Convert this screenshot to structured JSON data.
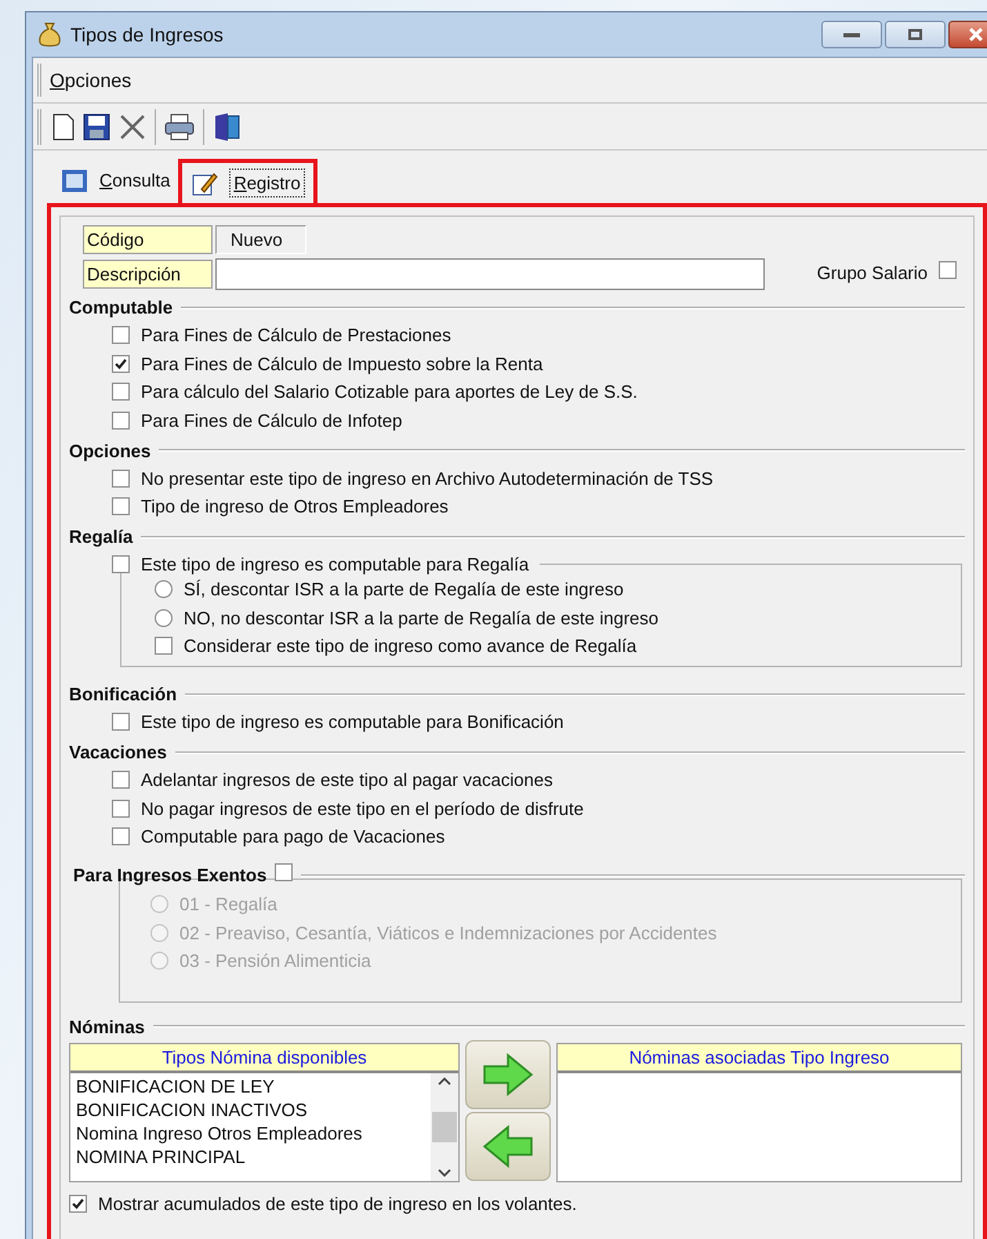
{
  "window": {
    "title": "Tipos de Ingresos"
  },
  "menu": [
    {
      "label": "Opciones"
    }
  ],
  "tabs": [
    {
      "label": "Consulta",
      "selected": false
    },
    {
      "label": "Registro",
      "selected": true
    }
  ],
  "form": {
    "code_label": "Código",
    "code_value": "Nuevo",
    "description_label": "Descripción",
    "group_label": "Grupo Salario",
    "group_checked": false
  },
  "sections": [
    {
      "title": "Computable",
      "kind": "list",
      "items": [
        {
          "kind": "checkbox",
          "label": "Para Fines de Cálculo de Prestaciones",
          "checked": false
        },
        {
          "kind": "checkbox",
          "label": "Para Fines de Cálculo de Impuesto sobre la Renta",
          "checked": true
        },
        {
          "kind": "checkbox",
          "label": "Para cálculo del Salario Cotizable para aportes de Ley de S.S.",
          "checked": false
        },
        {
          "kind": "checkbox",
          "label": "Para Fines de Cálculo de Infotep",
          "checked": false
        }
      ]
    },
    {
      "title": "Opciones",
      "kind": "list",
      "items": [
        {
          "kind": "checkbox",
          "label": "No presentar este tipo de ingreso en Archivo Autodeterminación de TSS",
          "checked": false
        },
        {
          "kind": "checkbox",
          "label": "Tipo de ingreso de Otros Empleadores",
          "checked": false
        }
      ]
    },
    {
      "title": "Regalía",
      "kind": "list",
      "items": [
        {
          "kind": "group",
          "label": "Este tipo de ingreso es computable para Regalía",
          "checked": false,
          "children": [
            {
              "kind": "radio",
              "label": "SÍ, descontar ISR a la parte de Regalía de este ingreso",
              "selected": false,
              "disabled": false
            },
            {
              "kind": "radio",
              "label": "NO, no descontar ISR a la parte de Regalía de este ingreso",
              "selected": false,
              "disabled": false
            },
            {
              "kind": "checkbox",
              "label": "Considerar este tipo de ingreso como avance de Regalía",
              "checked": false,
              "disabled": false
            }
          ]
        }
      ]
    },
    {
      "title": "Bonificación",
      "kind": "list",
      "items": [
        {
          "kind": "checkbox",
          "label": "Este tipo de ingreso es computable para Bonificación",
          "checked": false
        }
      ]
    },
    {
      "title": "Vacaciones",
      "kind": "list",
      "items": [
        {
          "kind": "checkbox",
          "label": "Adelantar ingresos de este tipo al pagar vacaciones",
          "checked": false
        },
        {
          "kind": "checkbox",
          "label": "No pagar ingresos de este tipo en el período de disfrute",
          "checked": false
        },
        {
          "kind": "checkbox",
          "label": "Computable para pago de Vacaciones",
          "checked": false
        }
      ]
    },
    {
      "title": "Para Ingresos Exentos",
      "kind": "framed",
      "checked": false,
      "items": [
        {
          "kind": "radio",
          "label": "01 - Regalía",
          "selected": false,
          "disabled": true
        },
        {
          "kind": "radio",
          "label": "02 - Preaviso, Cesantía, Viáticos e Indemnizaciones por Accidentes",
          "selected": false,
          "disabled": true
        },
        {
          "kind": "radio",
          "label": "03 - Pensión Alimenticia",
          "selected": false,
          "disabled": true
        }
      ]
    }
  ],
  "payrolls": {
    "title": "Nóminas",
    "available_header": "Tipos Nómina disponibles",
    "available": [
      "BONIFICACION DE LEY",
      "BONIFICACION INACTIVOS",
      "Nomina Ingreso Otros Empleadores",
      "NOMINA PRINCIPAL"
    ],
    "associated_header": "Nóminas asociadas Tipo Ingreso"
  },
  "show_accumulated": {
    "label": "Mostrar acumulados de este tipo de ingreso en los volantes.",
    "checked": true
  }
}
